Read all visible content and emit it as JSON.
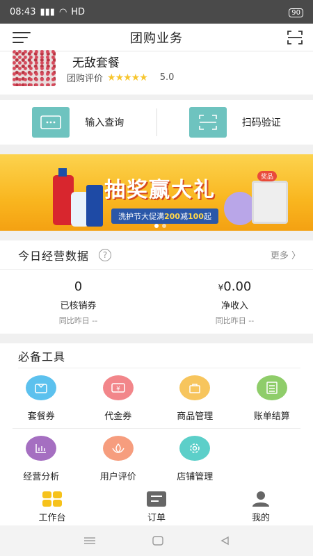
{
  "status_bar": {
    "time": "08:43",
    "network": "HD",
    "battery": "90"
  },
  "header": {
    "title": "团购业务"
  },
  "package": {
    "name": "无敌套餐",
    "rating_label": "团购评价",
    "stars": "★★★★★",
    "score": "5.0"
  },
  "actions": [
    {
      "label": "输入查询",
      "icon": "keyboard-icon"
    },
    {
      "label": "扫码验证",
      "icon": "scan-icon"
    }
  ],
  "banner": {
    "headline": "抽奖赢大礼",
    "promo_prefix": "洗护节大促满",
    "promo_num1": "200",
    "promo_mid": "减",
    "promo_num2": "100",
    "promo_suffix": "起",
    "tag": "奖品",
    "slide_index": 1,
    "slide_count": 2
  },
  "today": {
    "title": "今日经营数据",
    "help": "?",
    "more": "更多",
    "stats": [
      {
        "value": "0",
        "currency": "",
        "label": "已核销券",
        "compare": "同比昨日 --"
      },
      {
        "value": "0.00",
        "currency": "¥",
        "label": "净收入",
        "compare": "同比昨日 --"
      }
    ]
  },
  "tools": {
    "title": "必备工具",
    "items": [
      {
        "label": "套餐券",
        "icon": "package-coupon-icon",
        "color": "#5cc1ee"
      },
      {
        "label": "代金券",
        "icon": "voucher-icon",
        "color": "#f2868a"
      },
      {
        "label": "商品管理",
        "icon": "bag-icon",
        "color": "#f7c55d"
      },
      {
        "label": "账单结算",
        "icon": "calculator-icon",
        "color": "#8fcd6a"
      },
      {
        "label": "经营分析",
        "icon": "bar-chart-icon",
        "color": "#a56fc1"
      },
      {
        "label": "用户评价",
        "icon": "lotus-icon",
        "color": "#f69d7e"
      },
      {
        "label": "店铺管理",
        "icon": "gear-icon",
        "color": "#5ccfc9"
      }
    ]
  },
  "tabbar": [
    {
      "label": "工作台",
      "icon": "workbench-icon",
      "color": "#f6c21b"
    },
    {
      "label": "订单",
      "icon": "order-icon",
      "color": "#666666"
    },
    {
      "label": "我的",
      "icon": "profile-icon",
      "color": "#666666"
    }
  ],
  "colors": {
    "accent_teal": "#6ec3bf",
    "banner_yellow": "#f9b61f"
  }
}
